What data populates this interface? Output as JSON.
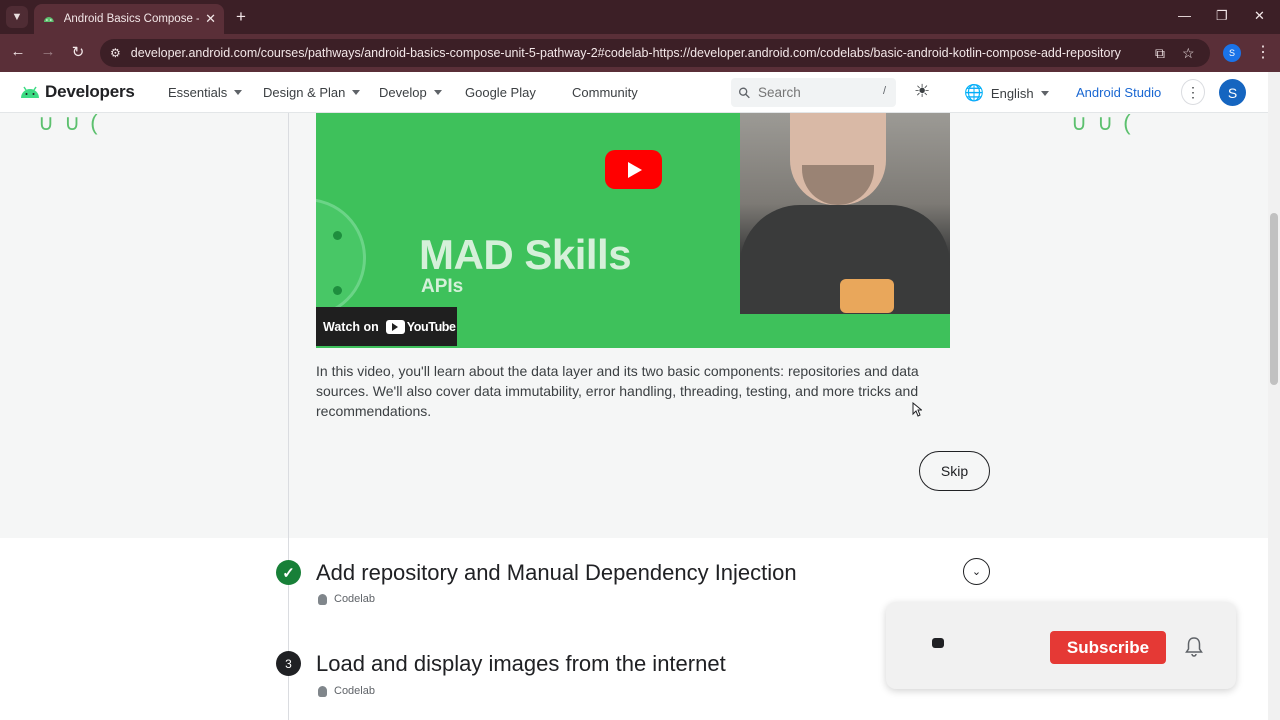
{
  "browser": {
    "tab_title": "Android Basics Compose - Load",
    "url": "developer.android.com/courses/pathways/android-basics-compose-unit-5-pathway-2#codelab-https://developer.android.com/codelabs/basic-android-kotlin-compose-add-repository",
    "profile_initial": "S"
  },
  "header": {
    "logo_text": "Developers",
    "nav": [
      "Essentials",
      "Design & Plan",
      "Develop",
      "Google Play",
      "Community"
    ],
    "search_placeholder": "Search",
    "search_shortcut": "/",
    "language": "English",
    "studio_link": "Android Studio",
    "avatar_initial": "S"
  },
  "video": {
    "title_big": "MAD Skills",
    "title_sub": "APIs",
    "watch_on": "Watch on",
    "youtube": "YouTube",
    "description": "In this video, you'll learn about the data layer and its two basic components: repositories and data sources. We'll also cover data immutability, error handling, threading, testing, and more tricks and recommendations."
  },
  "skip_label": "Skip",
  "steps": [
    {
      "title": "Add repository and Manual Dependency Injection",
      "type": "Codelab",
      "status": "completed"
    },
    {
      "number": "3",
      "title": "Load and display images from the internet",
      "type": "Codelab"
    }
  ],
  "subscribe_label": "Subscribe",
  "colors": {
    "accent": "#1967d2",
    "video_green": "#3ec15b",
    "subscribe_red": "#e53935",
    "complete_green": "#188038"
  }
}
